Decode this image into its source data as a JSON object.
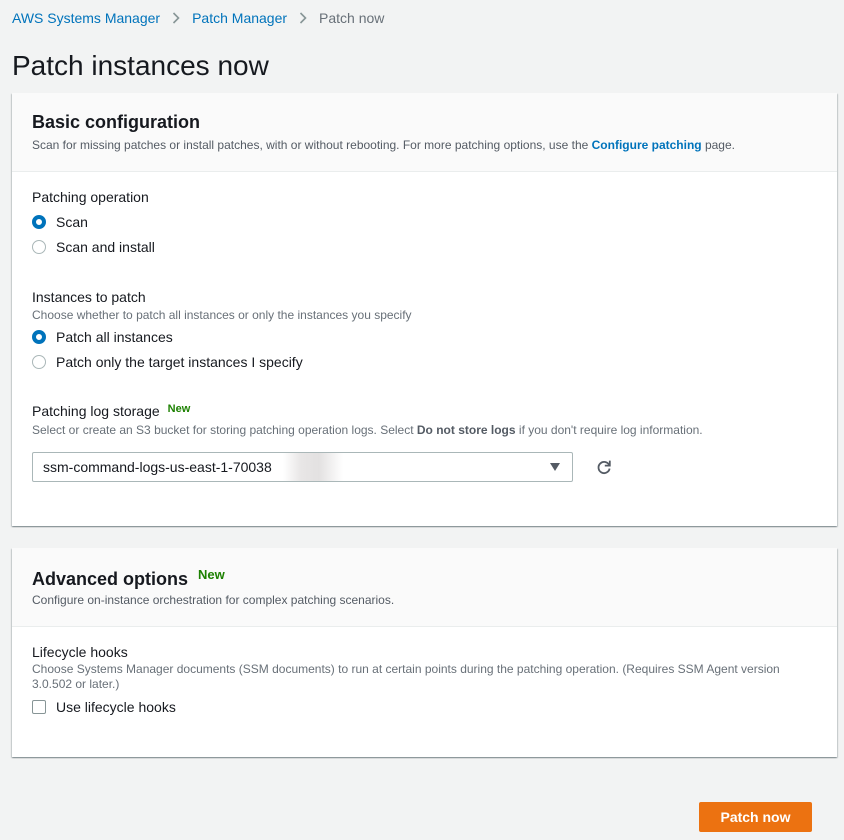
{
  "breadcrumb": {
    "items": [
      "AWS Systems Manager",
      "Patch Manager"
    ],
    "current": "Patch now"
  },
  "page": {
    "title": "Patch instances now"
  },
  "basic_config": {
    "title": "Basic configuration",
    "desc_prefix": "Scan for missing patches or install patches, with or without rebooting. For more patching options, use the ",
    "desc_link": "Configure patching",
    "desc_suffix": " page.",
    "patching_operation": {
      "label": "Patching operation",
      "options": [
        "Scan",
        "Scan and install"
      ],
      "selected": "Scan"
    },
    "instances_to_patch": {
      "label": "Instances to patch",
      "desc": "Choose whether to patch all instances or only the instances you specify",
      "options": [
        "Patch all instances",
        "Patch only the target instances I specify"
      ],
      "selected": "Patch all instances"
    },
    "log_storage": {
      "label": "Patching log storage",
      "badge": "New",
      "desc_prefix": "Select or create an S3 bucket for storing patching operation logs. Select ",
      "desc_bold": "Do not store logs",
      "desc_suffix": " if you don't require log information.",
      "value": "ssm-command-logs-us-east-1-70038"
    }
  },
  "advanced": {
    "title": "Advanced options",
    "badge": "New",
    "desc": "Configure on-instance orchestration for complex patching scenarios.",
    "lifecycle": {
      "label": "Lifecycle hooks",
      "desc": "Choose Systems Manager documents (SSM documents) to run at certain points during the patching operation. (Requires SSM Agent version 3.0.502 or later.)",
      "checkbox_label": "Use lifecycle hooks",
      "checked": false
    }
  },
  "actions": {
    "patch_now": "Patch now"
  },
  "colors": {
    "accent": "#0073bb",
    "primary": "#ec7211",
    "new": "#1d8102"
  },
  "icons": [
    "chevron-right-icon",
    "dropdown-caret-icon",
    "refresh-icon"
  ]
}
